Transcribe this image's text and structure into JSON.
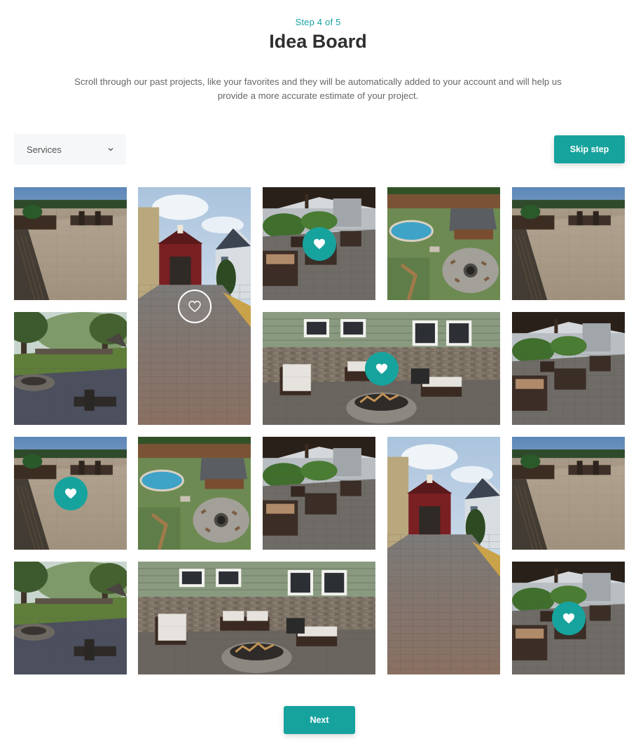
{
  "header": {
    "step": "Step 4 of 5",
    "title": "Idea Board",
    "description": "Scroll through our past projects, like your favorites and they will be automatically added to your account and will help us provide a more accurate estimate of your project."
  },
  "filter": {
    "selected": "Services",
    "icon": "chevron-down-icon"
  },
  "actions": {
    "skip_label": "Skip step",
    "next_label": "Next"
  },
  "colors": {
    "accent": "#17a39d",
    "step_text": "#17a2a0"
  },
  "gallery": {
    "photos": [
      {
        "scene": "patio-grill",
        "liked": false
      },
      {
        "scene": "walkway-barn",
        "liked": false,
        "hover": true
      },
      {
        "scene": "pergola-seating",
        "liked": true
      },
      {
        "scene": "pool-aerial",
        "liked": false
      },
      {
        "scene": "patio-grill",
        "liked": false
      },
      {
        "scene": "garden-firepit",
        "liked": false
      },
      {
        "scene": "house-firepit",
        "liked": true
      },
      {
        "scene": "pergola-seating",
        "liked": false
      },
      {
        "scene": "patio-grill",
        "liked": true
      },
      {
        "scene": "pool-aerial",
        "liked": false
      },
      {
        "scene": "pergola-seating",
        "liked": false
      },
      {
        "scene": "walkway-barn",
        "liked": false
      },
      {
        "scene": "patio-grill",
        "liked": false
      },
      {
        "scene": "garden-firepit",
        "liked": false
      },
      {
        "scene": "house-firepit",
        "liked": false
      },
      {
        "scene": "pergola-seating",
        "liked": true
      }
    ]
  }
}
